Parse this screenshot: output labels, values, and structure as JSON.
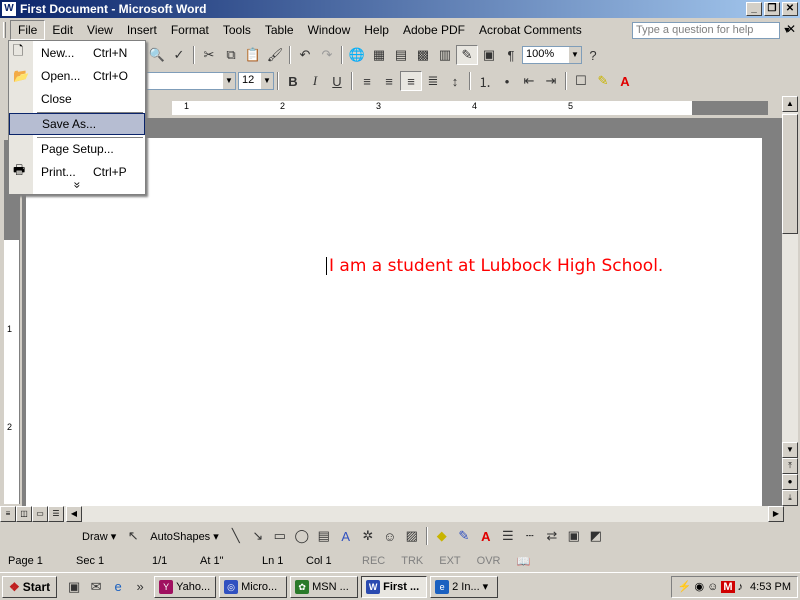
{
  "window": {
    "title": "First Document - Microsoft Word",
    "app_icon": "W"
  },
  "menubar": {
    "items": [
      "File",
      "Edit",
      "View",
      "Insert",
      "Format",
      "Tools",
      "Table",
      "Window",
      "Help",
      "Adobe PDF",
      "Acrobat Comments"
    ]
  },
  "help_box": {
    "placeholder": "Type a question for help"
  },
  "toolbar": {
    "zoom": "100%",
    "font_size": "12"
  },
  "file_menu": {
    "items": [
      {
        "label": "New...",
        "shortcut": "Ctrl+N"
      },
      {
        "label": "Open...",
        "shortcut": "Ctrl+O"
      },
      {
        "label": "Close",
        "shortcut": ""
      },
      {
        "label": "Save As...",
        "shortcut": ""
      },
      {
        "label": "Page Setup...",
        "shortcut": ""
      },
      {
        "label": "Print...",
        "shortcut": "Ctrl+P"
      }
    ],
    "expand": "»"
  },
  "ruler": {
    "numbers": [
      "1",
      "2",
      "3",
      "4",
      "5"
    ],
    "vnumbers": [
      "1",
      "2"
    ]
  },
  "document": {
    "text": "I am a student at Lubbock High School."
  },
  "drawbar": {
    "draw": "Draw",
    "autoshapes": "AutoShapes"
  },
  "status": {
    "page": "Page 1",
    "sec": "Sec 1",
    "pages": "1/1",
    "at": "At 1\"",
    "ln": "Ln 1",
    "col": "Col 1",
    "rec": "REC",
    "trk": "TRK",
    "ext": "EXT",
    "ovr": "OVR"
  },
  "taskbar": {
    "start": "Start",
    "tasks": [
      {
        "label": "Yaho...",
        "color": "#a01060"
      },
      {
        "label": "Micro...",
        "color": "#3050c0"
      },
      {
        "label": "MSN ...",
        "color": "#2a7a2a"
      },
      {
        "label": "First ...",
        "color": "#2a4ab0"
      },
      {
        "label": "2 In...",
        "color": "#1a60c0"
      }
    ],
    "clock": "4:53 PM"
  }
}
